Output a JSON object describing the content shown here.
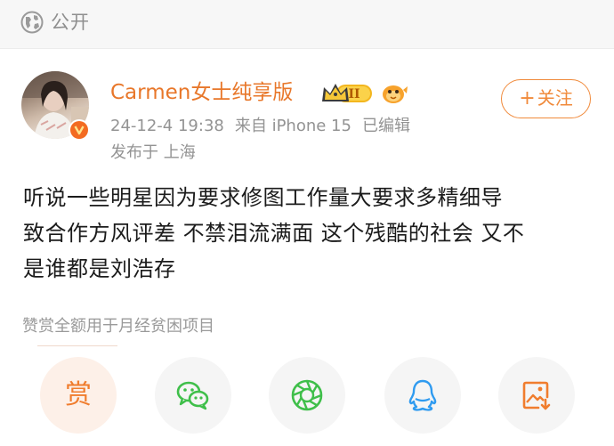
{
  "visibility": {
    "label": "公开"
  },
  "user": {
    "name": "Carmen女士纯享版",
    "vip_level": "II"
  },
  "meta": {
    "time": "24-12-4 19:38",
    "device": "来自 iPhone 15",
    "edited": "已编辑",
    "location": "发布于 上海"
  },
  "follow": {
    "label": "关注"
  },
  "post": {
    "lines": [
      "听说一些明星因为要求修图工作量大要求多精细导",
      "致合作方风评差 不禁泪流满面 这个残酷的社会 又不",
      "是谁都是刘浩存"
    ]
  },
  "reward": {
    "note": "赞赏全额用于月经贫困项目",
    "button_label": "赏"
  },
  "colors": {
    "accent": "#f08a3b",
    "wechat": "#3fbf4a",
    "moments": "#3fbf4a",
    "qq": "#2f9bf0",
    "image": "#f07d2e"
  },
  "share_icons": [
    "wechat-icon",
    "moments-icon",
    "qq-icon",
    "save-image-icon"
  ]
}
